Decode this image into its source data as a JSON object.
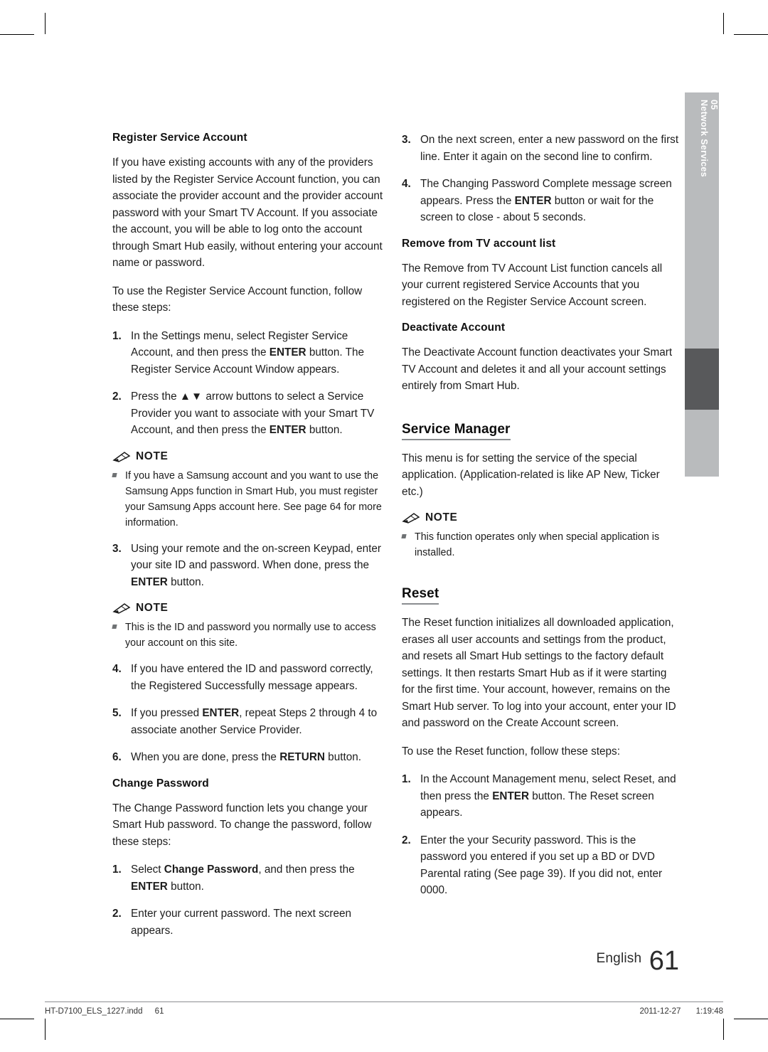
{
  "sidebar_tab": {
    "number": "05",
    "label": "Network Services"
  },
  "left_column": {
    "h_register": "Register Service Account",
    "p_register_1": "If you have existing accounts with any of the providers listed by the Register Service Account function, you can associate the provider account and the provider account password with your Smart TV Account. If you associate the account, you will be able to log onto the account through Smart Hub easily, without entering your account name or password.",
    "p_register_2": "To use the Register Service Account function, follow these steps:",
    "steps_a": [
      {
        "n": "1.",
        "t": "In the Settings menu, select Register Service Account, and then press the ENTER button. The Register Service Account Window appears."
      },
      {
        "n": "2.",
        "t": "Press the ▲▼ arrow buttons to select a Service Provider you want to associate with your Smart TV Account, and then press the ENTER button."
      }
    ],
    "note1_title": "NOTE",
    "note1_bullets": [
      "If you have a Samsung account and you want to use the Samsung Apps function in Smart Hub, you must register your Samsung Apps account here. See page 64 for more information."
    ],
    "steps_b": [
      {
        "n": "3.",
        "t": "Using your remote and the on-screen Keypad, enter your site ID and password. When done, press the ENTER button."
      }
    ],
    "note2_title": "NOTE",
    "note2_bullets": [
      "This is the ID and password you normally use to access your account on this site."
    ],
    "steps_c": [
      {
        "n": "4.",
        "t": "If you have entered the ID and password correctly, the Registered Successfully message appears."
      },
      {
        "n": "5.",
        "t": "If you pressed ENTER, repeat Steps 2 through 4 to associate another Service Provider."
      },
      {
        "n": "6.",
        "t": "When you are done, press the RETURN button."
      }
    ],
    "h_change_password": "Change Password",
    "p_change_password": "The Change Password function lets you change your Smart Hub password. To change the password, follow these steps:",
    "steps_d": [
      {
        "n": "1.",
        "t": "Select Change Password, and then press the ENTER button."
      },
      {
        "n": "2.",
        "t": "Enter your current password. The next screen appears."
      }
    ]
  },
  "right_column": {
    "steps_e": [
      {
        "n": "3.",
        "t": "On the next screen, enter a new password on the first line. Enter it again on the second line to confirm."
      },
      {
        "n": "4.",
        "t": "The Changing Password Complete message screen appears. Press the ENTER button or wait for the screen to close - about 5 seconds."
      }
    ],
    "h_remove": "Remove from TV account list",
    "p_remove": "The Remove from TV Account List function cancels all your current registered Service Accounts that you registered on the Register Service Account screen.",
    "h_deactivate": "Deactivate Account",
    "p_deactivate": "The Deactivate Account function deactivates your Smart TV Account and deletes it and all your account settings entirely from Smart Hub.",
    "h_service_manager": "Service Manager",
    "p_service_manager": "This menu is for setting the service of the special application. (Application-related is like AP New, Ticker etc.)",
    "note3_title": "NOTE",
    "note3_bullets": [
      "This function operates only when special application is installed."
    ],
    "h_reset": "Reset",
    "p_reset_1": "The Reset function initializes all downloaded application, erases all user accounts and settings from the product, and resets all Smart Hub settings to the factory default settings. It then restarts Smart Hub as if it were starting for the first time. Your account, however, remains on the Smart Hub server. To log into your account, enter your ID and password on the Create Account screen.",
    "p_reset_2": "To use the Reset function, follow these steps:",
    "steps_f": [
      {
        "n": "1.",
        "t": "In the Account Management menu, select Reset, and then press the ENTER button. The Reset screen appears."
      },
      {
        "n": "2.",
        "t": "Enter the your Security password. This is the password you entered if you set up a BD or DVD Parental rating (See page 39). If you did not, enter 0000."
      }
    ]
  },
  "footer": {
    "language": "English",
    "page_number": "61",
    "file_name": "HT-D7100_ELS_1227.indd",
    "file_page": "61",
    "date": "2011-12-27",
    "time": "1:19:48"
  },
  "colors": {
    "tab_light": "#b9bbbd",
    "tab_dark": "#58595b",
    "heading_rule": "#8a8d90",
    "text": "#1d1d1d"
  }
}
